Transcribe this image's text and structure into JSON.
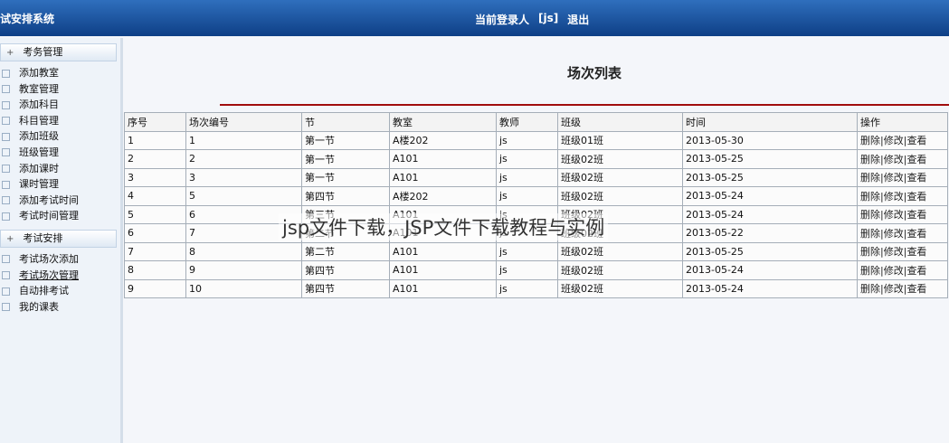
{
  "header": {
    "app_title": "试安排系统",
    "current_user_label": "当前登录人",
    "current_user": "[js]",
    "logout": "退出"
  },
  "sidebar": {
    "sections": [
      {
        "title": "考务管理",
        "items": [
          "添加教室",
          "教室管理",
          "添加科目",
          "科目管理",
          "添加班级",
          "班级管理",
          "添加课时",
          "课时管理",
          "添加考试时间",
          "考试时间管理"
        ]
      },
      {
        "title": "考试安排",
        "items": [
          "考试场次添加",
          "考试场次管理",
          "自动排考试",
          "我的课表"
        ]
      }
    ]
  },
  "main": {
    "title": "场次列表",
    "columns": [
      "序号",
      "场次编号",
      "节",
      "教室",
      "教师",
      "班级",
      "时间",
      "操作"
    ],
    "rows": [
      [
        "1",
        "1",
        "第一节",
        "A楼202",
        "js",
        "班级01班",
        "2013-05-30"
      ],
      [
        "2",
        "2",
        "第一节",
        "A101",
        "js",
        "班级02班",
        "2013-05-25"
      ],
      [
        "3",
        "3",
        "第一节",
        "A101",
        "js",
        "班级02班",
        "2013-05-25"
      ],
      [
        "4",
        "5",
        "第四节",
        "A楼202",
        "js",
        "班级02班",
        "2013-05-24"
      ],
      [
        "5",
        "6",
        "第三节",
        "A101",
        "js",
        "班级02班",
        "2013-05-24"
      ],
      [
        "6",
        "7",
        "第二节",
        "A101",
        "js",
        "班级02班",
        "2013-05-22"
      ],
      [
        "7",
        "8",
        "第二节",
        "A101",
        "js",
        "班级02班",
        "2013-05-25"
      ],
      [
        "8",
        "9",
        "第四节",
        "A101",
        "js",
        "班级02班",
        "2013-05-24"
      ],
      [
        "9",
        "10",
        "第四节",
        "A101",
        "js",
        "班级02班",
        "2013-05-24"
      ]
    ],
    "actions": [
      "删除",
      "修改",
      "查看"
    ],
    "action_separator": "|"
  },
  "watermark": "jsp文件下载，JSP文件下载教程与实例"
}
